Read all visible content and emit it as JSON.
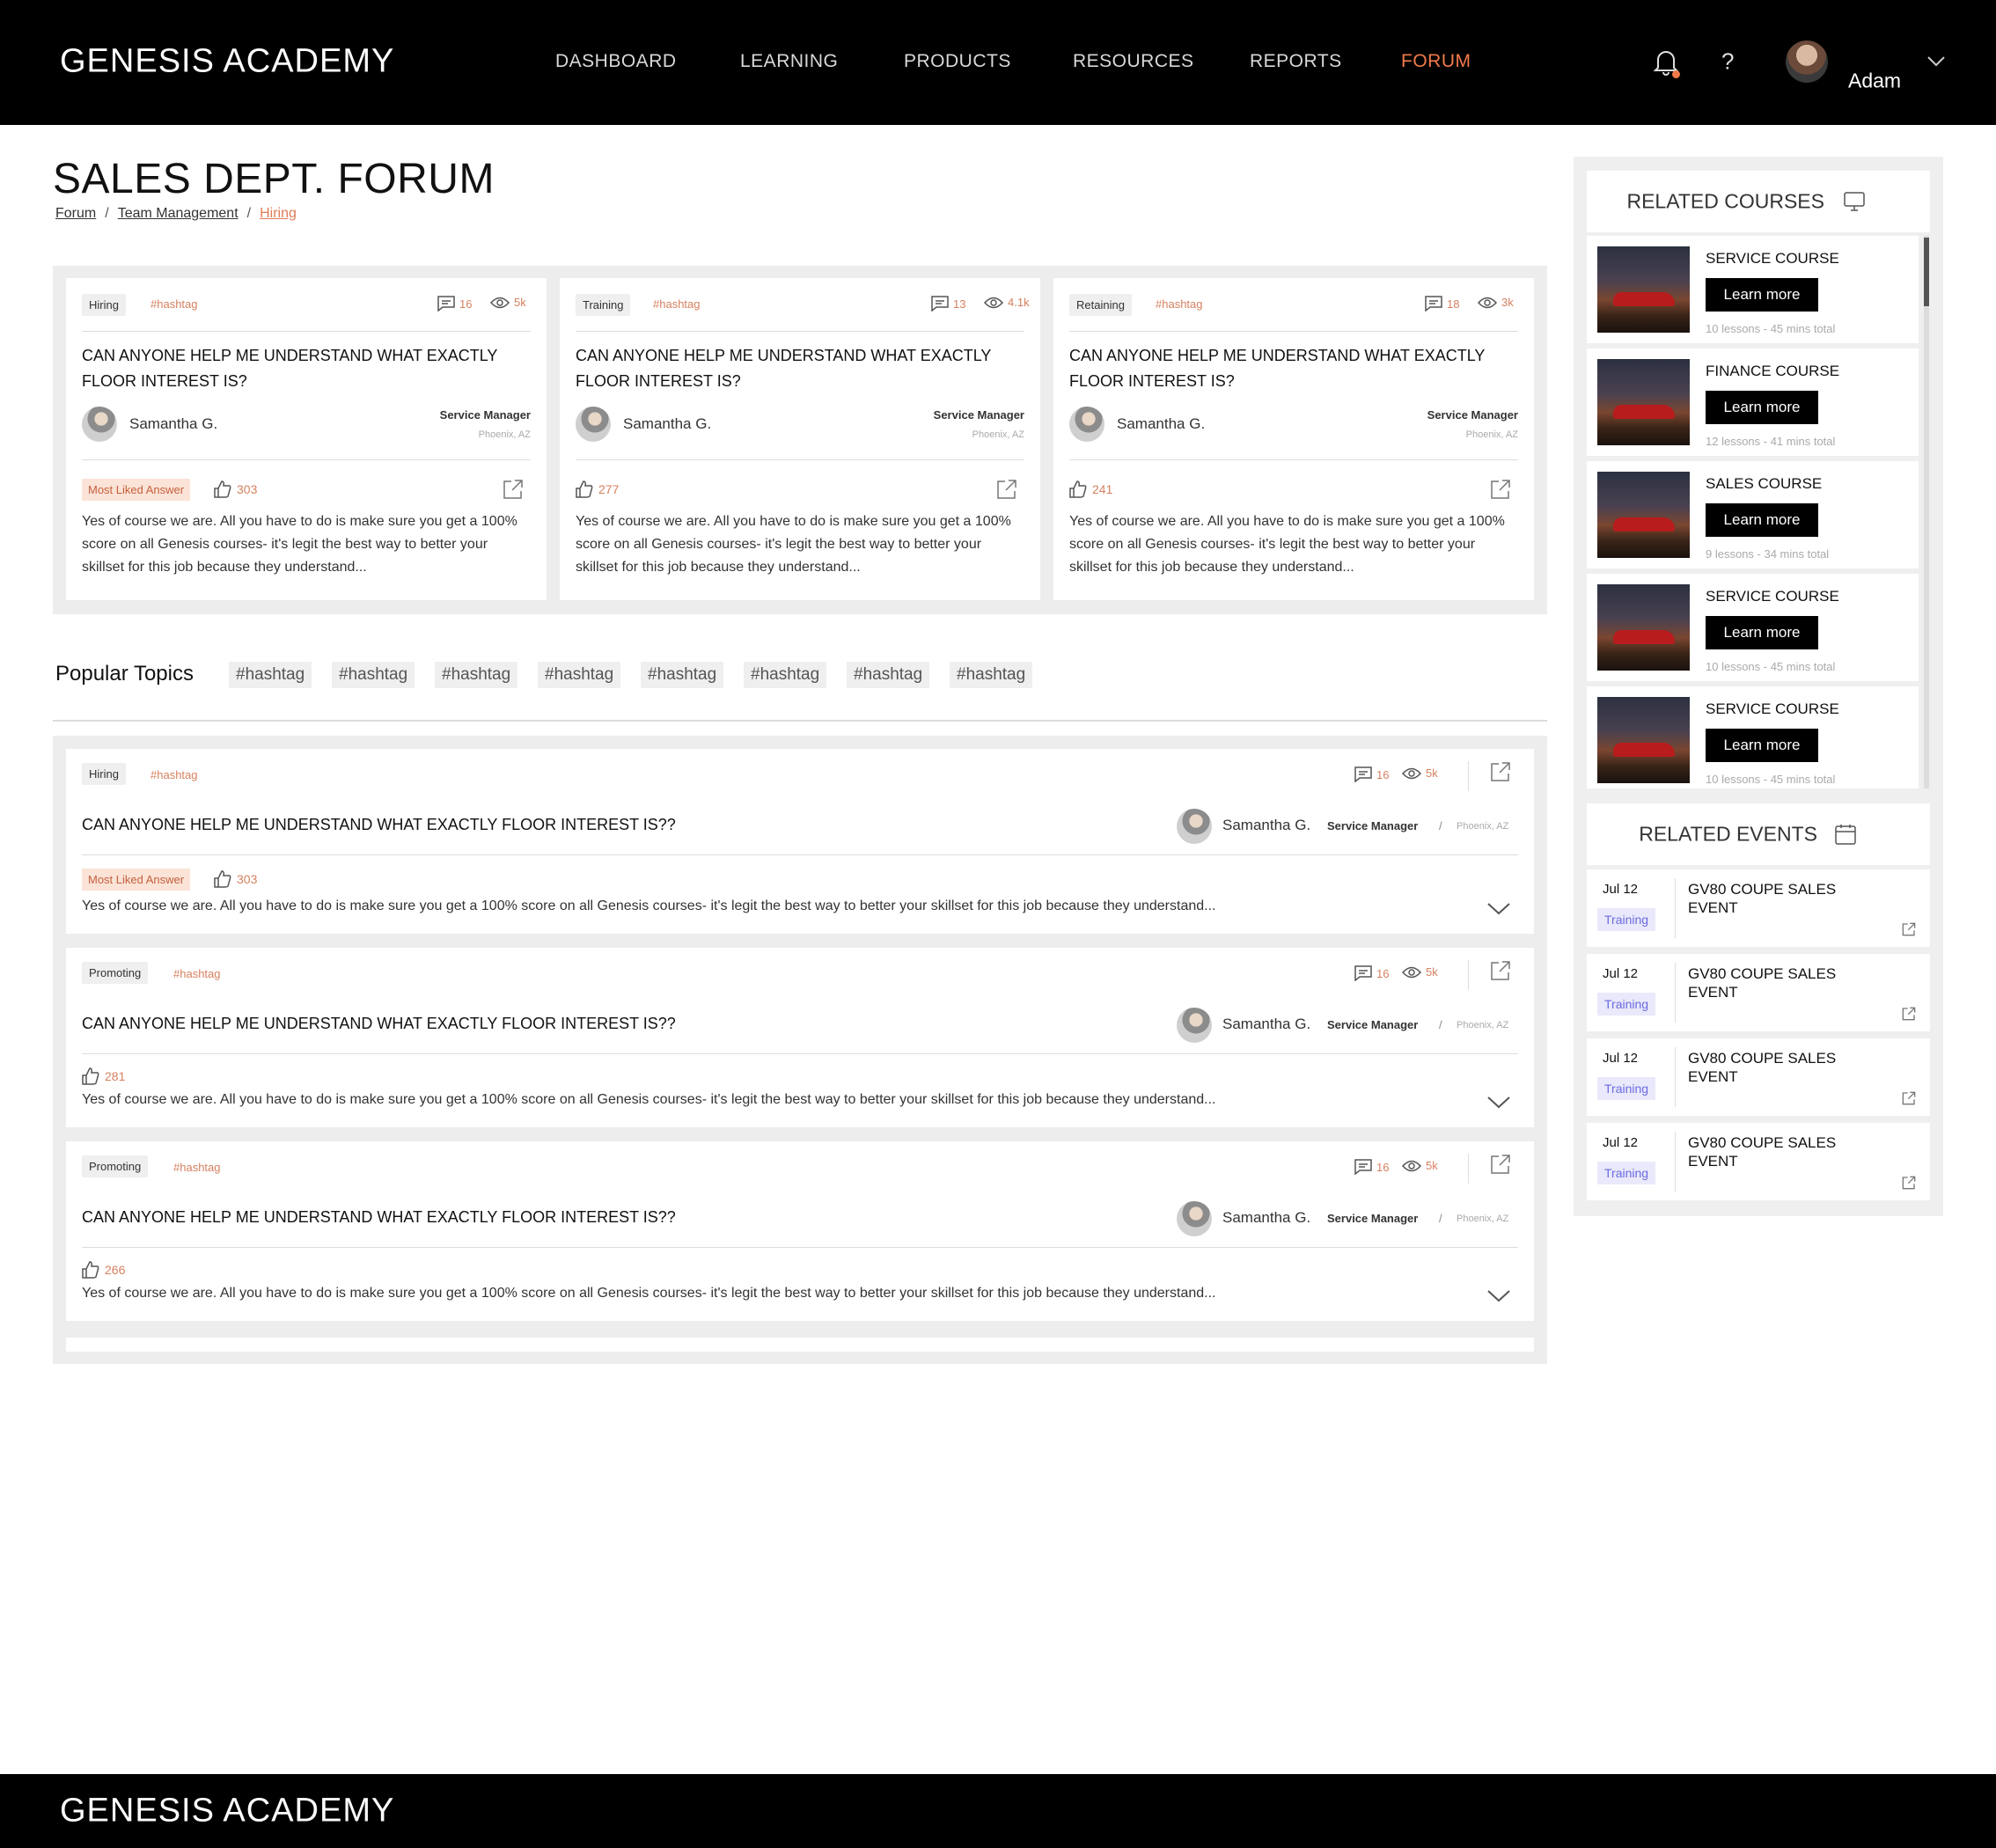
{
  "header": {
    "logo": "GENESIS ACADEMY",
    "nav": [
      "DASHBOARD",
      "LEARNING",
      "PRODUCTS",
      "RESOURCES",
      "REPORTS",
      "FORUM"
    ],
    "active_nav": "FORUM",
    "help": "?",
    "user": "Adam"
  },
  "page": {
    "title": "SALES DEPT. FORUM",
    "breadcrumb": [
      "Forum",
      "Team Management",
      "Hiring"
    ]
  },
  "featured": [
    {
      "category": "Hiring",
      "hashtag": "#hashtag",
      "comments": "16",
      "views": "5k",
      "question": "CAN ANYONE HELP ME UNDERSTAND WHAT EXACTLY FLOOR INTEREST IS?",
      "author": "Samantha G.",
      "role": "Service Manager",
      "location": "Phoenix, AZ",
      "badge": "Most Liked Answer",
      "likes": "303",
      "answer": "Yes of course we are. All you have to do is make sure you get a 100% score on all Genesis courses- it's legit the best way to better your skillset for this job because they understand..."
    },
    {
      "category": "Training",
      "hashtag": "#hashtag",
      "comments": "13",
      "views": "4.1k",
      "question": "CAN ANYONE HELP ME UNDERSTAND WHAT EXACTLY FLOOR INTEREST IS?",
      "author": "Samantha G.",
      "role": "Service Manager",
      "location": "Phoenix, AZ",
      "badge": "",
      "likes": "277",
      "answer": "Yes of course we are. All you have to do is make sure you get a 100% score on all Genesis courses- it's legit the best way to better your skillset for this job because they understand..."
    },
    {
      "category": "Retaining",
      "hashtag": "#hashtag",
      "comments": "18",
      "views": "3k",
      "question": "CAN ANYONE HELP ME UNDERSTAND WHAT EXACTLY FLOOR INTEREST IS?",
      "author": "Samantha G.",
      "role": "Service Manager",
      "location": "Phoenix, AZ",
      "badge": "",
      "likes": "241",
      "answer": "Yes of course we are. All you have to do is make sure you get a 100% score on all Genesis courses- it's legit the best way to better your skillset for this job because they understand..."
    }
  ],
  "popular": {
    "label": "Popular Topics",
    "topics": [
      "#hashtag",
      "#hashtag",
      "#hashtag",
      "#hashtag",
      "#hashtag",
      "#hashtag",
      "#hashtag",
      "#hashtag"
    ]
  },
  "posts": [
    {
      "category": "Hiring",
      "hashtag": "#hashtag",
      "comments": "16",
      "views": "5k",
      "question": "CAN ANYONE HELP ME UNDERSTAND WHAT EXACTLY FLOOR INTEREST IS??",
      "author": "Samantha G.",
      "role": "Service Manager",
      "sep": "/",
      "location": "Phoenix, AZ",
      "badge": "Most Liked Answer",
      "likes": "303",
      "answer": "Yes of course we are. All you have to do is make sure you get a 100% score on all Genesis courses- it's legit the best way to better your skillset for this job because they understand..."
    },
    {
      "category": "Promoting",
      "hashtag": "#hashtag",
      "comments": "16",
      "views": "5k",
      "question": "CAN ANYONE HELP ME UNDERSTAND WHAT EXACTLY FLOOR INTEREST IS??",
      "author": "Samantha G.",
      "role": "Service Manager",
      "sep": "/",
      "location": "Phoenix, AZ",
      "badge": "",
      "likes": "281",
      "answer": "Yes of course we are. All you have to do is make sure you get a 100% score on all Genesis courses- it's legit the best way to better your skillset for this job because they understand..."
    },
    {
      "category": "Promoting",
      "hashtag": "#hashtag",
      "comments": "16",
      "views": "5k",
      "question": "CAN ANYONE HELP ME UNDERSTAND WHAT EXACTLY FLOOR INTEREST IS??",
      "author": "Samantha G.",
      "role": "Service Manager",
      "sep": "/",
      "location": "Phoenix, AZ",
      "badge": "",
      "likes": "266",
      "answer": "Yes of course we are. All you have to do is make sure you get a 100% score on all Genesis courses- it's legit the best way to better your skillset for this job because they understand..."
    }
  ],
  "sidebar": {
    "courses_title": "RELATED COURSES",
    "courses": [
      {
        "title": "SERVICE COURSE",
        "button": "Learn more",
        "meta": "10 lessons - 45 mins total"
      },
      {
        "title": "FINANCE COURSE",
        "button": "Learn more",
        "meta": "12 lessons - 41 mins total"
      },
      {
        "title": "SALES COURSE",
        "button": "Learn more",
        "meta": "9 lessons - 34 mins total"
      },
      {
        "title": "SERVICE COURSE",
        "button": "Learn more",
        "meta": "10 lessons - 45 mins total"
      },
      {
        "title": "SERVICE COURSE",
        "button": "Learn more",
        "meta": "10 lessons - 45 mins total"
      }
    ],
    "events_title": "RELATED EVENTS",
    "events": [
      {
        "date": "Jul 12",
        "tag": "Training",
        "title": "GV80 COUPE SALES EVENT"
      },
      {
        "date": "Jul 12",
        "tag": "Training",
        "title": "GV80 COUPE SALES EVENT"
      },
      {
        "date": "Jul 12",
        "tag": "Training",
        "title": "GV80 COUPE SALES EVENT"
      },
      {
        "date": "Jul 12",
        "tag": "Training",
        "title": "GV80 COUPE SALES EVENT"
      }
    ]
  },
  "footer": {
    "logo": "GENESIS ACADEMY"
  },
  "colors": {
    "accent": "#f07a4a",
    "hashtag": "#d6805f",
    "badge_bg": "#fbe3d7",
    "event_tag": "#6a6ae0"
  }
}
